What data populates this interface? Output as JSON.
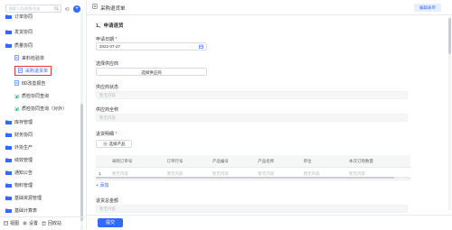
{
  "search": {
    "placeholder": "搜索人员/权限/目录"
  },
  "nav": {
    "items": [
      {
        "label": "订单协同",
        "type": "folder"
      },
      {
        "label": "发货协同",
        "type": "folder"
      },
      {
        "label": "质量协同",
        "type": "folder"
      },
      {
        "label": "来料检验单",
        "type": "doc"
      },
      {
        "label": "采购退货单",
        "type": "doc",
        "active": true
      },
      {
        "label": "8D改善报告",
        "type": "doc"
      },
      {
        "label": "质检协同查询",
        "type": "chart"
      },
      {
        "label": "质检协同查询（对外）",
        "type": "chart"
      },
      {
        "label": "库存管理",
        "type": "folder"
      },
      {
        "label": "财务协同",
        "type": "folder"
      },
      {
        "label": "外协生产",
        "type": "folder"
      },
      {
        "label": "绩效管理",
        "type": "folder"
      },
      {
        "label": "通知公告",
        "type": "folder"
      },
      {
        "label": "物料管理",
        "type": "folder"
      },
      {
        "label": "基础资源管理",
        "type": "folder"
      },
      {
        "label": "基础计算表",
        "type": "folder"
      }
    ]
  },
  "footer": {
    "view": "视图",
    "settings": "设置",
    "recycle": "回收站"
  },
  "topbar": {
    "title": "采购退货单",
    "action": "编辑表单"
  },
  "form": {
    "section": "1、申请退货",
    "date_label": "申请日期",
    "date_value": "2022-07-27",
    "supplier_label": "选择供应商",
    "supplier_button": "选择供应商",
    "status_label": "供应商状态",
    "status_placeholder": "暂无内容",
    "fullname_label": "供应商全称",
    "fullname_placeholder": "暂无内容",
    "detail_label": "退货明细",
    "choose_product": "选择产品",
    "add_label": "+ 添加",
    "total_label": "退货总金额",
    "total_placeholder": "暂无内容",
    "submit": "提交"
  },
  "table": {
    "headers": [
      "",
      "采购订单号",
      "订单行号",
      "产品编号",
      "产品名称",
      "单位",
      "本次订购数量"
    ],
    "rows": [
      [
        "1",
        "暂无内容",
        "暂无内容",
        "暂无内容",
        "暂无内容",
        "暂无内容",
        "暂无内容"
      ]
    ]
  }
}
